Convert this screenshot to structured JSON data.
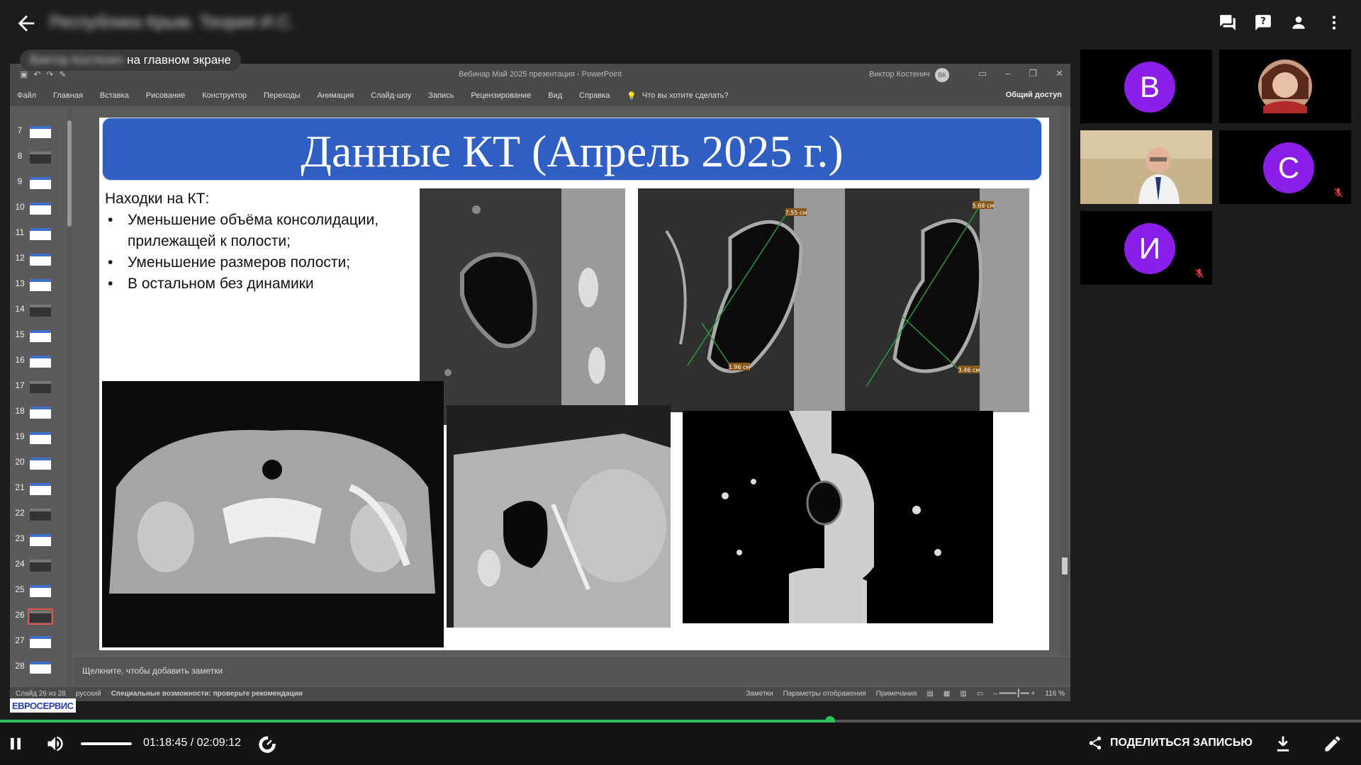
{
  "topbar": {
    "meeting_title": "Республика Крым. Теория И.С.",
    "icons": [
      "back-arrow-icon",
      "chat-icon",
      "question-icon",
      "person-icon",
      "more-vert-icon"
    ]
  },
  "main_screen_label": {
    "name": "Виктор Костенич",
    "suffix": "на главном экране"
  },
  "powerpoint": {
    "window_title": "Вебинар Май 2025 презентация  -  PowerPoint",
    "user": "Виктор Костенич",
    "user_initials": "ВК",
    "ribbon_tabs": [
      "Файл",
      "Главная",
      "Вставка",
      "Рисование",
      "Конструктор",
      "Переходы",
      "Анимация",
      "Слайд-шоу",
      "Запись",
      "Рецензирование",
      "Вид",
      "Справка"
    ],
    "tell_me": "Что вы хотите сделать?",
    "share": "Общий доступ",
    "thumbnails": [
      {
        "n": "7",
        "dark": false
      },
      {
        "n": "8",
        "dark": true
      },
      {
        "n": "9",
        "dark": false
      },
      {
        "n": "10",
        "dark": false
      },
      {
        "n": "11",
        "dark": false
      },
      {
        "n": "12",
        "dark": false
      },
      {
        "n": "13",
        "dark": false
      },
      {
        "n": "14",
        "dark": true
      },
      {
        "n": "15",
        "dark": false
      },
      {
        "n": "16",
        "dark": false
      },
      {
        "n": "17",
        "dark": true
      },
      {
        "n": "18",
        "dark": false
      },
      {
        "n": "19",
        "dark": false
      },
      {
        "n": "20",
        "dark": false
      },
      {
        "n": "21",
        "dark": false
      },
      {
        "n": "22",
        "dark": true
      },
      {
        "n": "23",
        "dark": false
      },
      {
        "n": "24",
        "dark": true
      },
      {
        "n": "25",
        "dark": false
      },
      {
        "n": "26",
        "dark": true,
        "selected": true
      },
      {
        "n": "27",
        "dark": false
      },
      {
        "n": "28",
        "dark": false
      }
    ],
    "slide": {
      "title": "Данные КТ (Апрель 2025 г.)",
      "findings_heading": "Находки на КТ:",
      "bullets": [
        "Уменьшение объёма консолидации, прилежащей к полости;",
        "Уменьшение размеров полости;",
        "В остальном без динамики"
      ],
      "measurements": [
        "7.55 см",
        "1.96 см",
        "5.68 см",
        "3.46 см"
      ]
    },
    "notes_placeholder": "Щелкните, чтобы добавить заметки",
    "status": {
      "slide_counter": "Слайд 26 из 28",
      "language": "русский",
      "accessibility": "Специальные возможности: проверьте рекомендации",
      "notes": "Заметки",
      "display_settings": "Параметры отображения",
      "comments": "Примечания",
      "zoom": "116 %"
    }
  },
  "participants": [
    {
      "initial": "В",
      "muted": false
    },
    {
      "initial": "",
      "muted": false,
      "photo": true
    },
    {
      "initial": "",
      "muted": false,
      "camera": true
    },
    {
      "initial": "С",
      "muted": true
    },
    {
      "initial": "И",
      "muted": true
    }
  ],
  "accent": "#8b1ee8",
  "player": {
    "logo": "ЕВРОСЕРВИС",
    "current_time": "01:18:45",
    "duration": "02:09:12",
    "time_display": "01:18:45 / 02:09:12",
    "progress": 0.61,
    "share_label": "ПОДЕЛИТЬСЯ ЗАПИСЬЮ",
    "progress_color": "#2fbf5a"
  }
}
